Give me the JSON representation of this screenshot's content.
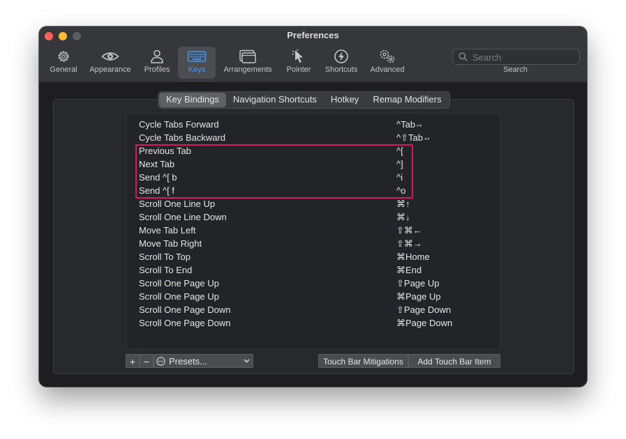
{
  "window": {
    "title": "Preferences",
    "toolbar": [
      {
        "label": "General",
        "icon": "gear-icon"
      },
      {
        "label": "Appearance",
        "icon": "eye-icon"
      },
      {
        "label": "Profiles",
        "icon": "person-icon"
      },
      {
        "label": "Keys",
        "icon": "keyboard-icon",
        "active": true
      },
      {
        "label": "Arrangements",
        "icon": "windows-icon"
      },
      {
        "label": "Pointer",
        "icon": "cursor-icon"
      },
      {
        "label": "Shortcuts",
        "icon": "bolt-icon"
      },
      {
        "label": "Advanced",
        "icon": "gears-icon"
      }
    ],
    "search": {
      "placeholder": "Search",
      "label": "Search"
    }
  },
  "tabs": [
    {
      "label": "Key Bindings",
      "active": true
    },
    {
      "label": "Navigation Shortcuts"
    },
    {
      "label": "Hotkey"
    },
    {
      "label": "Remap Modifiers"
    }
  ],
  "bindings": [
    {
      "action": "Cycle Tabs Forward",
      "key": "^Tab",
      "arrow": "↦"
    },
    {
      "action": "Cycle Tabs Backward",
      "key": "^⇧Tab",
      "arrow": "↤"
    },
    {
      "action": "Previous Tab",
      "key": "^["
    },
    {
      "action": "Next Tab",
      "key": "^]"
    },
    {
      "action": "Send ^[ b",
      "key": "^i"
    },
    {
      "action": "Send ^[ f",
      "key": "^o"
    },
    {
      "action": "Scroll One Line Up",
      "key": "⌘↑"
    },
    {
      "action": "Scroll One Line Down",
      "key": "⌘↓"
    },
    {
      "action": "Move Tab Left",
      "key": "⇧⌘←"
    },
    {
      "action": "Move Tab Right",
      "key": "⇧⌘→"
    },
    {
      "action": "Scroll To Top",
      "key": "⌘Home"
    },
    {
      "action": "Scroll To End",
      "key": "⌘End"
    },
    {
      "action": "Scroll One Page Up",
      "key": "⇧Page Up"
    },
    {
      "action": "Scroll One Page Up",
      "key": "⌘Page Up"
    },
    {
      "action": "Scroll One Page Down",
      "key": "⇧Page Down"
    },
    {
      "action": "Scroll One Page Down",
      "key": "⌘Page Down"
    }
  ],
  "bottom": {
    "add": "+",
    "remove": "−",
    "presets": "Presets...",
    "touch_bar_mitigations": "Touch Bar Mitigations",
    "add_touch_bar_item": "Add Touch Bar Item"
  },
  "colors": {
    "highlight": "#d71a5b",
    "accent": "#3d9bff"
  }
}
